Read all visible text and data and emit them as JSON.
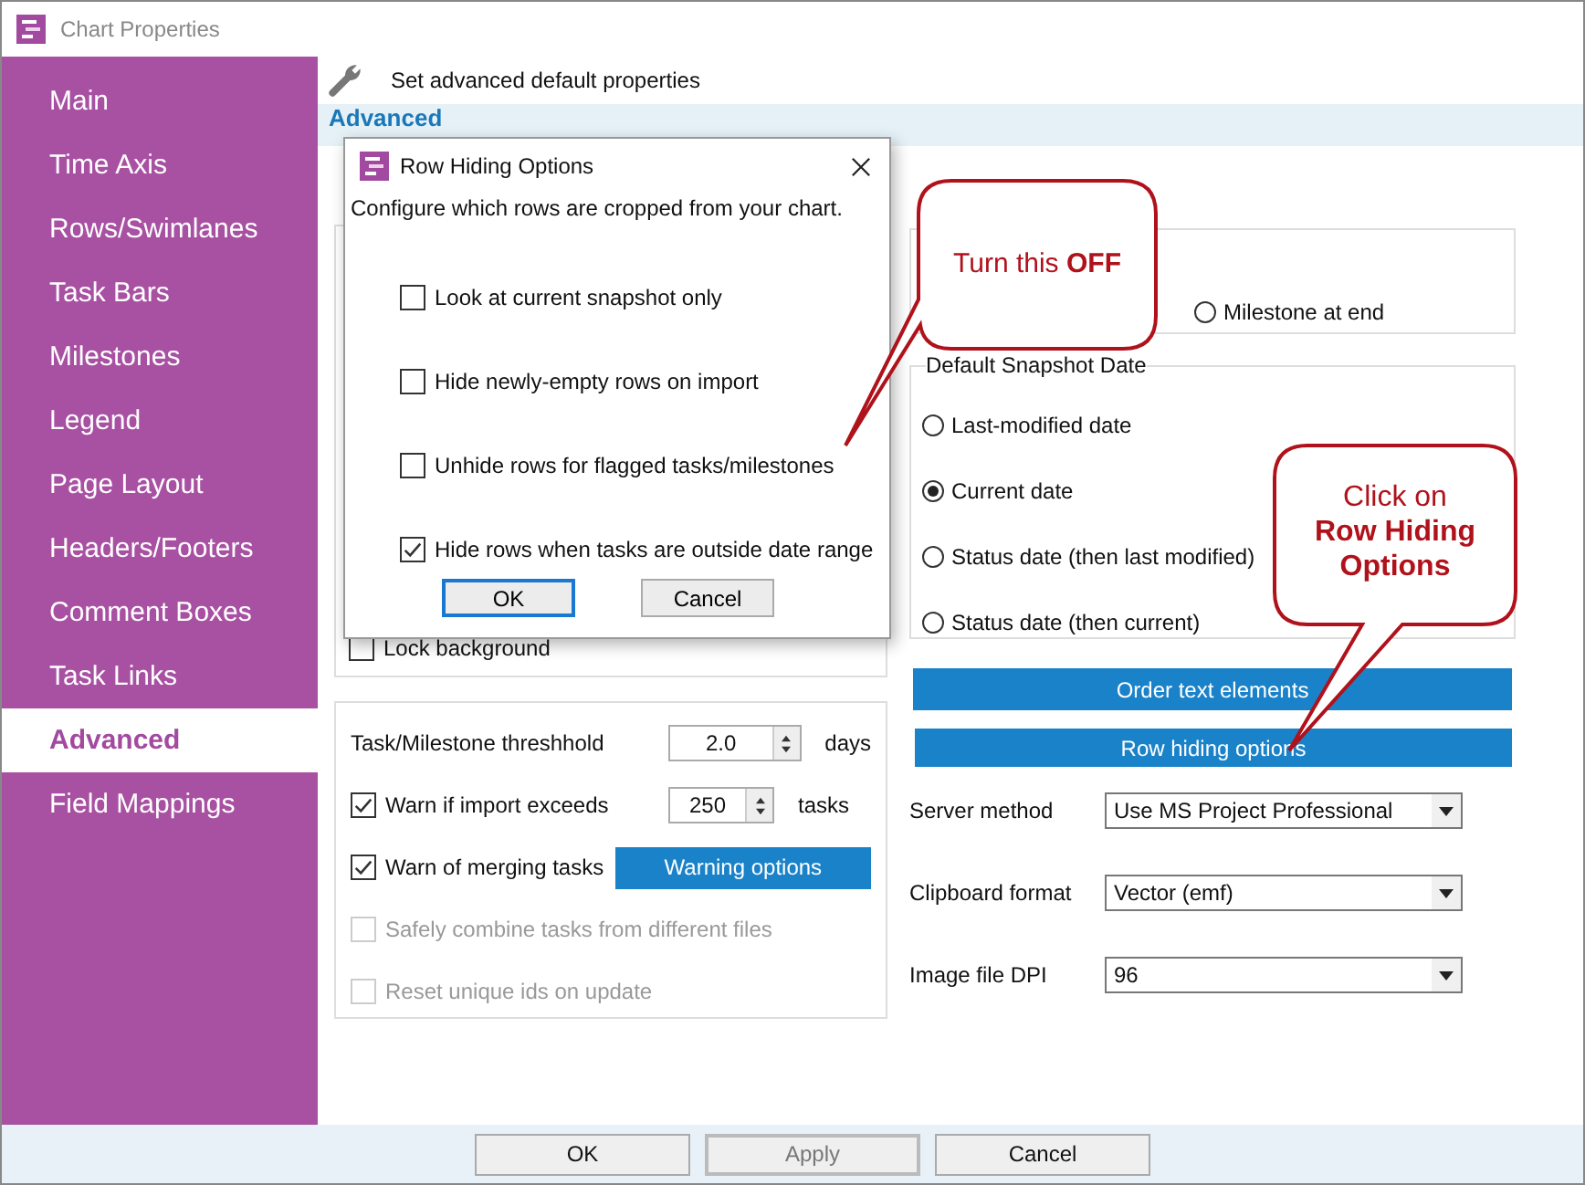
{
  "window": {
    "title": "Chart Properties"
  },
  "sidebar": {
    "items": [
      {
        "label": "Main",
        "selected": false
      },
      {
        "label": "Time Axis",
        "selected": false
      },
      {
        "label": "Rows/Swimlanes",
        "selected": false
      },
      {
        "label": "Task Bars",
        "selected": false
      },
      {
        "label": "Milestones",
        "selected": false
      },
      {
        "label": "Legend",
        "selected": false
      },
      {
        "label": "Page Layout",
        "selected": false
      },
      {
        "label": "Headers/Footers",
        "selected": false
      },
      {
        "label": "Comment Boxes",
        "selected": false
      },
      {
        "label": "Task Links",
        "selected": false
      },
      {
        "label": "Advanced",
        "selected": true
      },
      {
        "label": "Field Mappings",
        "selected": false
      }
    ]
  },
  "header": {
    "text": "Set advanced default properties",
    "section_title": "Advanced"
  },
  "lock_background": {
    "label": "Lock background",
    "checked": false
  },
  "settings": {
    "threshold": {
      "label": "Task/Milestone threshhold",
      "value": "2.0",
      "unit": "days"
    },
    "rows": [
      {
        "kind": "spin",
        "label": "Warn if import exceeds",
        "checked": true,
        "disabled": false,
        "value": "250",
        "unit": "tasks"
      },
      {
        "kind": "button",
        "label": "Warn of merging tasks",
        "checked": true,
        "disabled": false,
        "button": "Warning options"
      },
      {
        "kind": "plain",
        "label": "Safely combine tasks from different files",
        "checked": false,
        "disabled": true
      },
      {
        "kind": "plain",
        "label": "Reset unique ids on update",
        "checked": false,
        "disabled": true
      }
    ]
  },
  "milestone_group": {
    "options": [
      {
        "label": "Milestone at end",
        "selected": false
      }
    ]
  },
  "snapshot_date": {
    "title": "Default Snapshot Date",
    "options": [
      {
        "label": "Last-modified date",
        "selected": false
      },
      {
        "label": "Current date",
        "selected": true
      },
      {
        "label": "Status date (then last modified)",
        "selected": false
      },
      {
        "label": "Status date (then current)",
        "selected": false
      }
    ]
  },
  "action_buttons": [
    "Order text elements",
    "Row hiding options"
  ],
  "dropdowns": [
    {
      "label": "Server method",
      "value": "Use MS Project Professional"
    },
    {
      "label": "Clipboard format",
      "value": "Vector (emf)"
    },
    {
      "label": "Image file DPI",
      "value": "96"
    }
  ],
  "footer_buttons": [
    {
      "label": "OK",
      "disabled": false
    },
    {
      "label": "Apply",
      "disabled": true
    },
    {
      "label": "Cancel",
      "disabled": false
    }
  ],
  "dialog": {
    "title": "Row Hiding Options",
    "description": "Configure which rows are cropped from your chart.",
    "options": [
      {
        "label": "Look at current snapshot only",
        "checked": false
      },
      {
        "label": "Hide newly-empty rows on import",
        "checked": false
      },
      {
        "label": "Unhide rows for flagged tasks/milestones",
        "checked": false
      },
      {
        "label": "Hide rows when tasks are outside date range",
        "checked": true
      }
    ],
    "buttons": [
      {
        "label": "OK",
        "default": true
      },
      {
        "label": "Cancel",
        "default": false
      }
    ]
  },
  "callouts": [
    {
      "kind": "inline",
      "text": "Turn this **OFF**"
    },
    {
      "kind": "stacked",
      "text": "Click on **Row Hiding Options**"
    }
  ]
}
